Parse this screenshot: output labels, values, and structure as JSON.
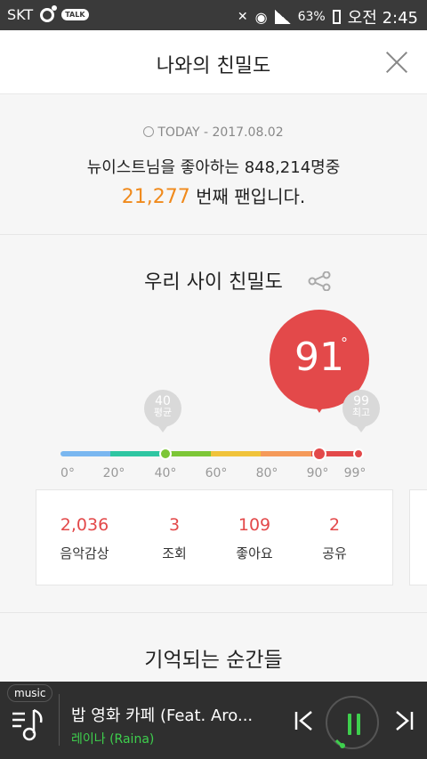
{
  "status_bar": {
    "carrier": "SKT",
    "talk_badge": "TALK",
    "battery": "63%",
    "time": "오전 2:45"
  },
  "header": {
    "title": "나와의 친밀도",
    "close_icon": "close-icon"
  },
  "summary": {
    "today_label": "TODAY - 2017.08.02",
    "line1": "뉴이스트님을 좋아하는 848,214명중",
    "rank": "21,277",
    "rank_suffix": " 번째 팬입니다."
  },
  "intimacy": {
    "title": "우리 사이 친밀도",
    "score": "91",
    "degree": "°",
    "average_value": "40",
    "average_label": "평균",
    "max_value": "99",
    "max_label": "최고",
    "score_fraction": 0.91,
    "average_fraction": 0.4,
    "max_fraction": 0.99,
    "ticks": [
      "0°",
      "20°",
      "40°",
      "60°",
      "80°",
      "90°",
      "99°"
    ],
    "scale_colors": [
      "#7ab7f0",
      "#2fc6a2",
      "#7dc637",
      "#f0c33b",
      "#f59a5a",
      "#e3494a"
    ]
  },
  "stats": [
    {
      "value": "2,036",
      "label": "음악감상"
    },
    {
      "value": "3",
      "label": "조회"
    },
    {
      "value": "109",
      "label": "좋아요"
    },
    {
      "value": "2",
      "label": "공유"
    }
  ],
  "memories": {
    "title": "기억되는 순간들"
  },
  "player": {
    "tag": "music",
    "song": "밥 영화 카페 (Feat. Aro...",
    "artist": "레이나 (Raina)"
  }
}
